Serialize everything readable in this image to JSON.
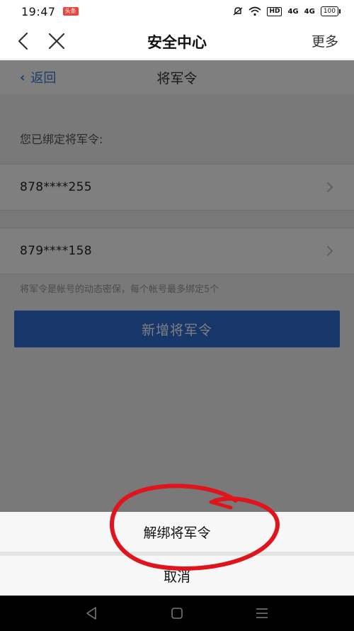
{
  "status_bar": {
    "time": "19:47",
    "app_badge": "头条",
    "hd_label": "HD",
    "signal_1": "4G",
    "signal_2": "4G",
    "battery": "100"
  },
  "title_bar": {
    "title": "安全中心",
    "more_label": "更多"
  },
  "sub_nav": {
    "back_label": "返回",
    "title": "将军令"
  },
  "content": {
    "bound_label": "您已绑定将军令:",
    "tokens": [
      {
        "number": "878****255"
      },
      {
        "number": "879****158"
      }
    ],
    "hint": "将军令是帐号的动态密保，每个帐号最多绑定5个",
    "add_button": "新增将军令"
  },
  "action_sheet": {
    "unbind_label": "解绑将军令",
    "cancel_label": "取消"
  },
  "colors": {
    "accent": "#2f6fd6",
    "link": "#3a78d0",
    "annotation": "#e0141c"
  }
}
